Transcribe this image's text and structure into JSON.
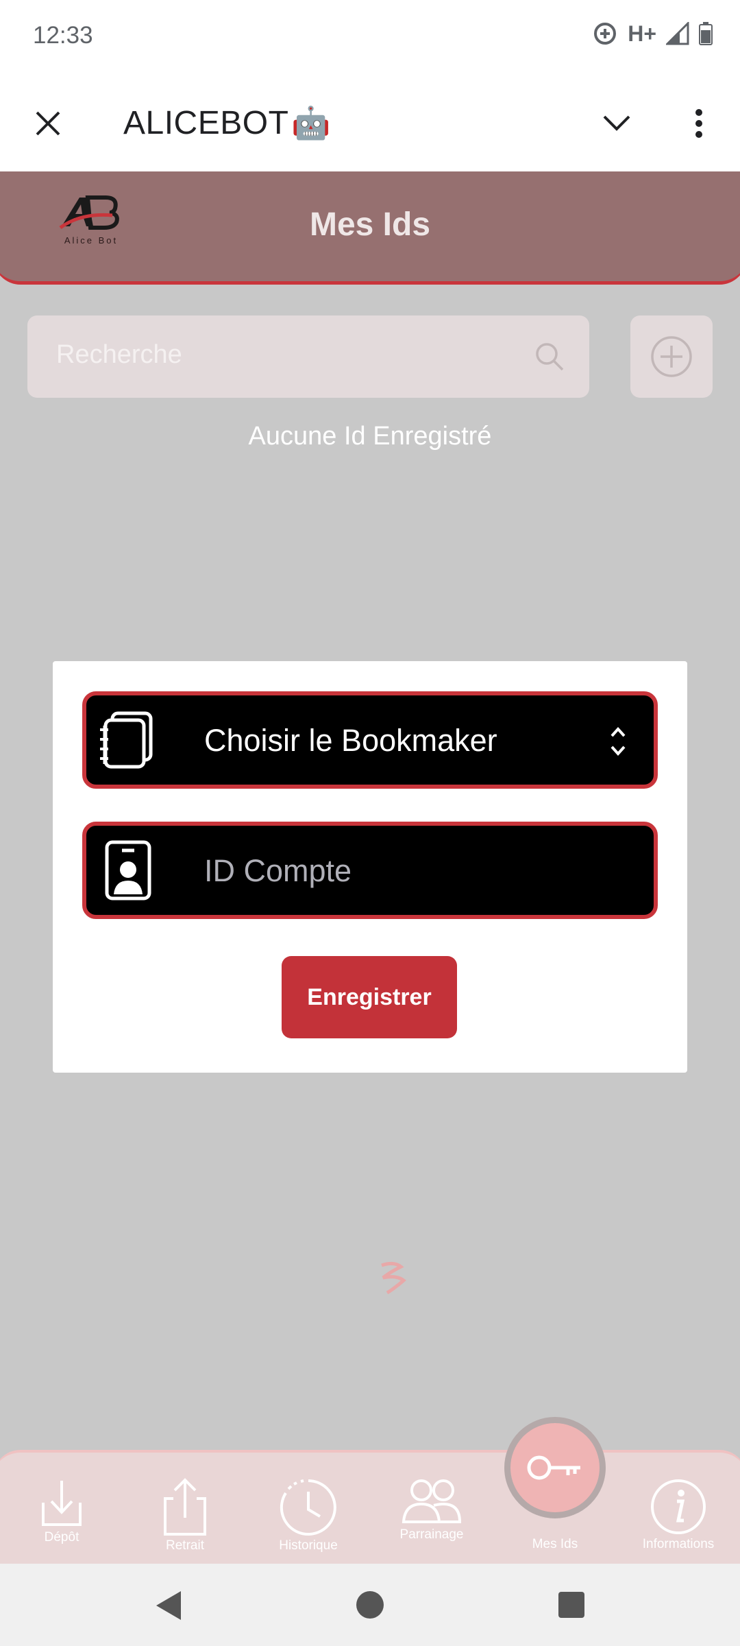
{
  "status_bar": {
    "time": "12:33",
    "network": "H+"
  },
  "app_bar": {
    "title": "ALICEBOT",
    "title_emoji": "🤖"
  },
  "header": {
    "title": "Mes Ids",
    "logo_text": "Alice Bot"
  },
  "search": {
    "placeholder": "Recherche"
  },
  "empty_state": {
    "text": "Aucune Id Enregistré"
  },
  "modal": {
    "bookmaker_label": "Choisir le Bookmaker",
    "account_placeholder": "ID Compte",
    "save_label": "Enregistrer"
  },
  "bottom_nav": {
    "items": [
      {
        "label": "Dépôt",
        "icon": "download-icon"
      },
      {
        "label": "Retrait",
        "icon": "upload-icon"
      },
      {
        "label": "Historique",
        "icon": "clock-icon"
      },
      {
        "label": "Parrainage",
        "icon": "users-icon"
      },
      {
        "label": "Mes Ids",
        "icon": "key-icon",
        "active": true
      },
      {
        "label": "Informations",
        "icon": "info-icon"
      }
    ]
  },
  "colors": {
    "accent": "#c9353b",
    "header_bg": "#967070",
    "overlay_bg": "#c8c8c8",
    "button_bg": "#c33239"
  }
}
